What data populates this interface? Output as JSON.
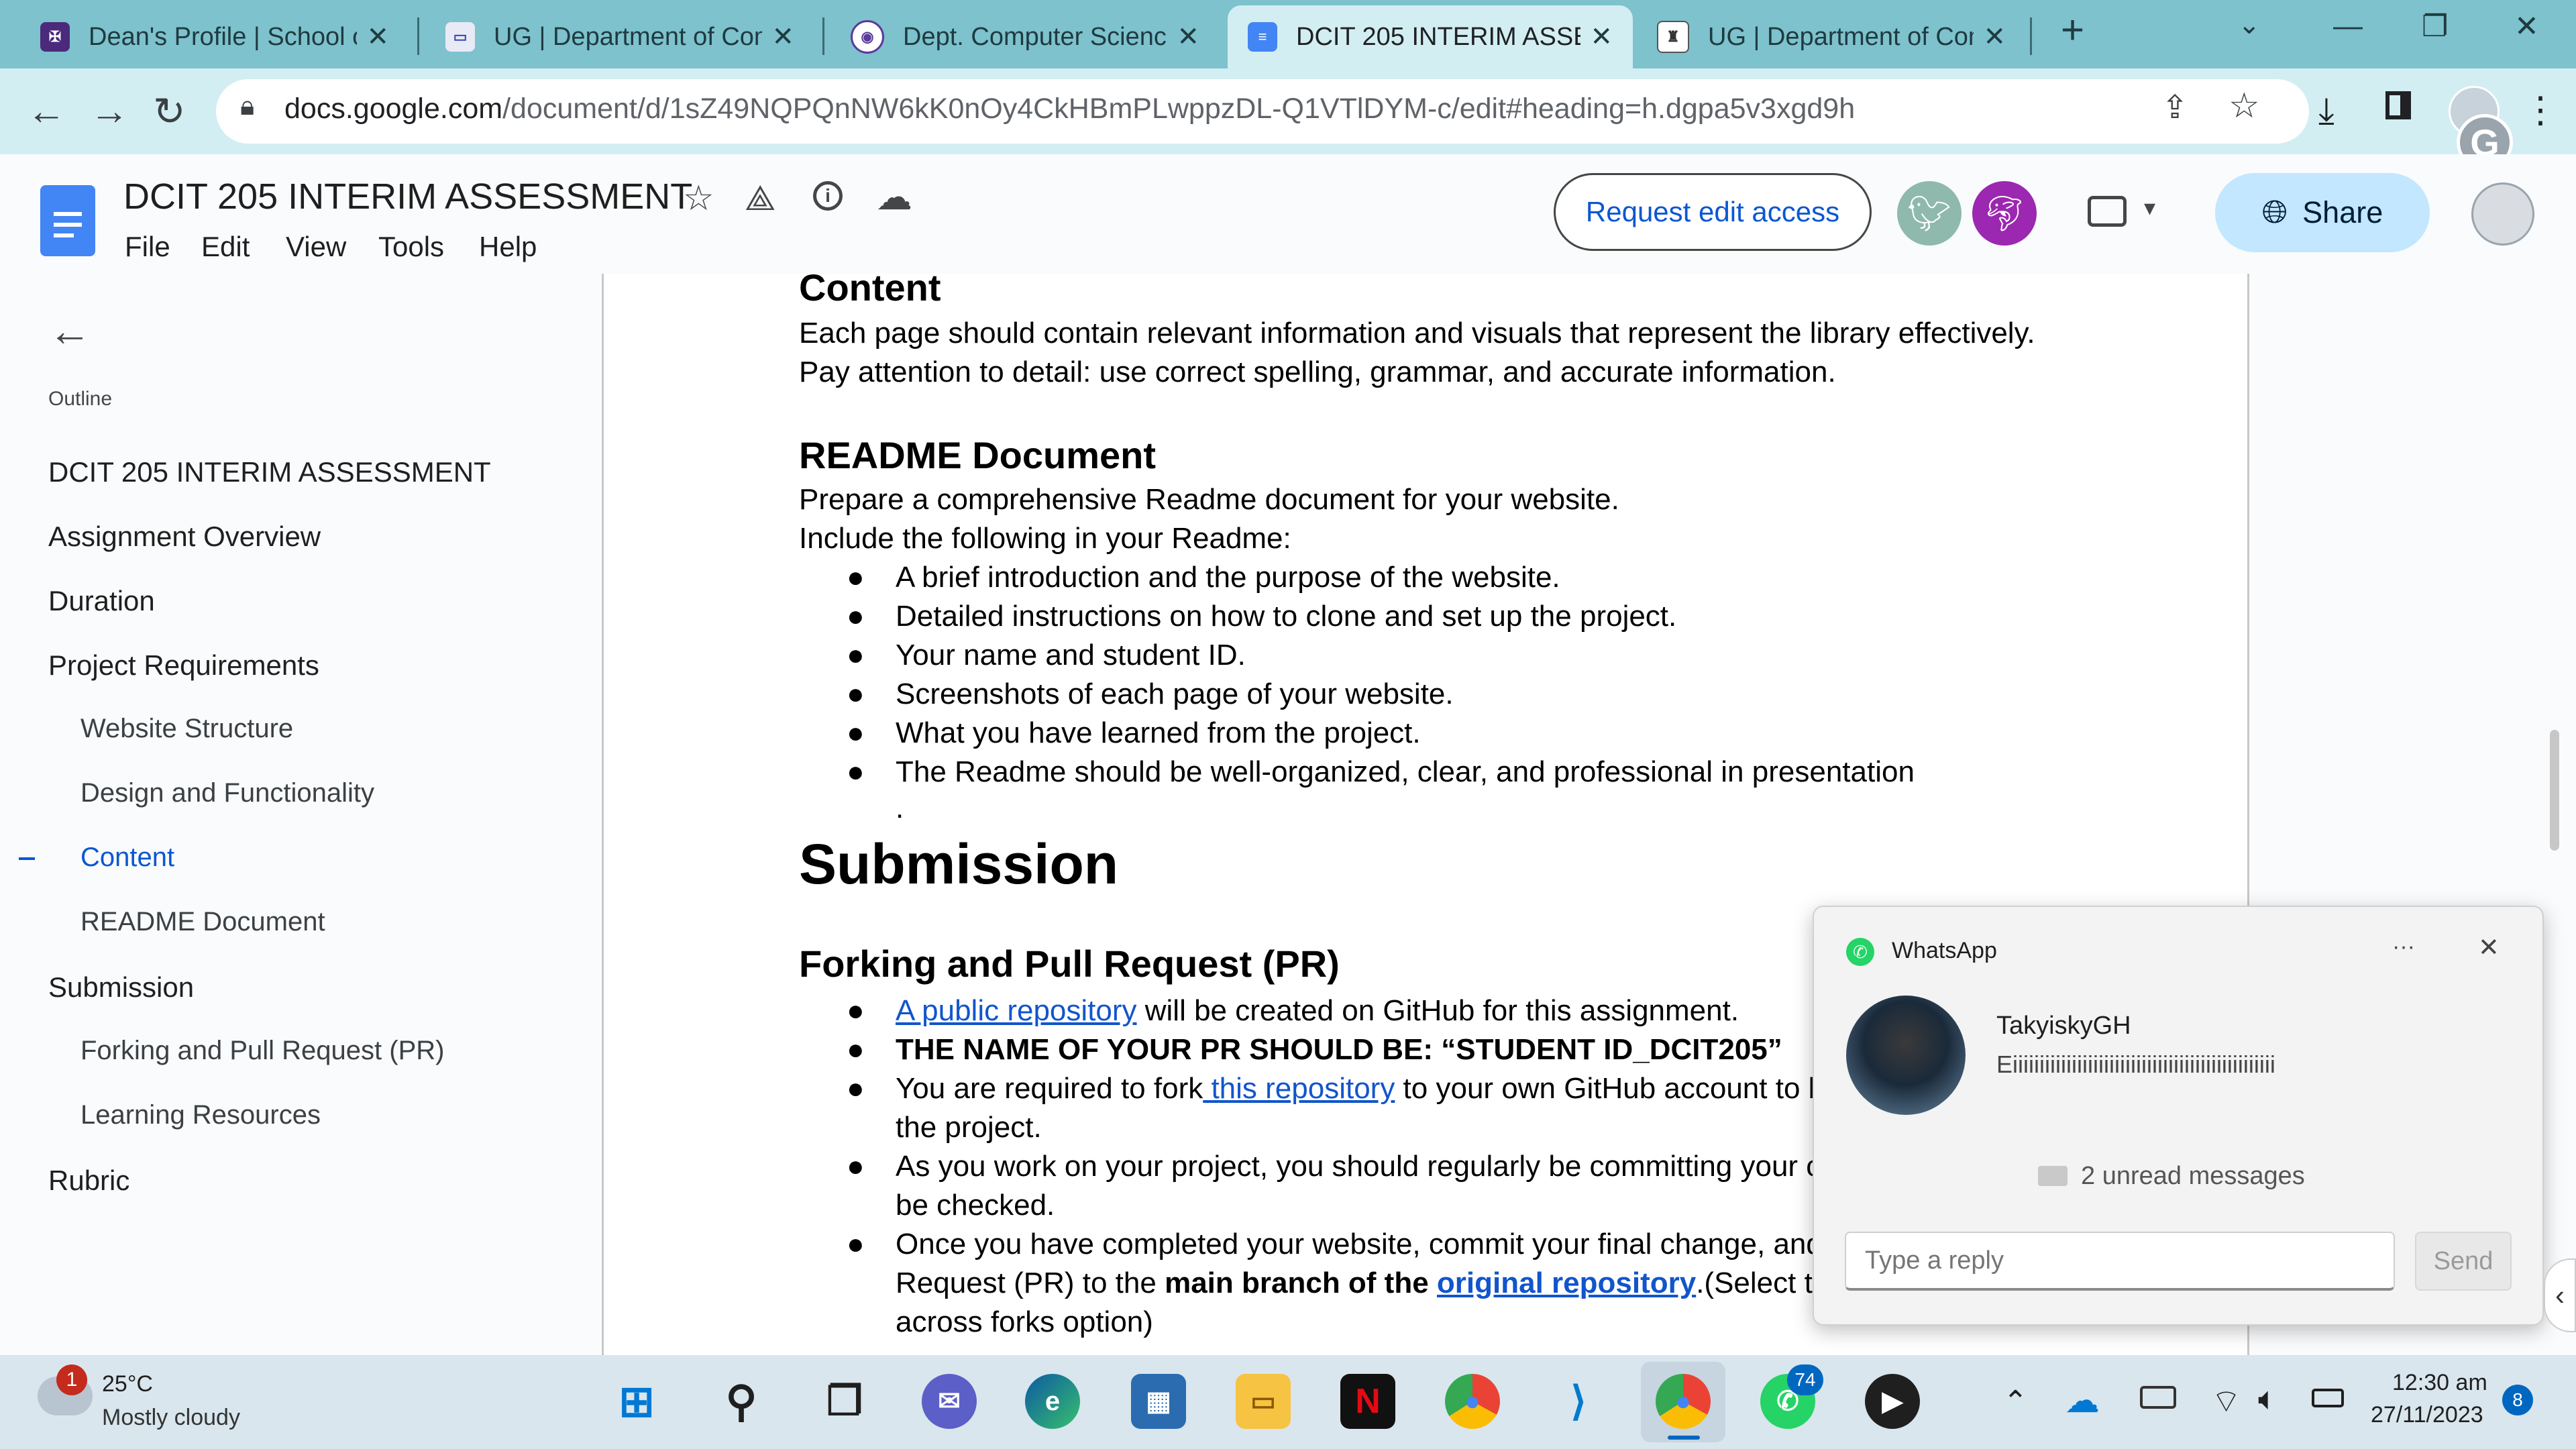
{
  "browser": {
    "tabs": [
      {
        "title": "Dean's Profile | School of",
        "active": false
      },
      {
        "title": "UG | Department of Com",
        "active": false
      },
      {
        "title": "Dept. Computer Science",
        "active": false
      },
      {
        "title": "DCIT 205 INTERIM ASSES",
        "active": true
      },
      {
        "title": "UG | Department of Com",
        "active": false
      }
    ],
    "url_host": "docs.google.com",
    "url_path": "/document/d/1sZ49NQPQnNW6kK0nOy4CkHBmPLwppzDL-Q1VTlDYM-c/edit#heading=h.dgpa5v3xgd9h"
  },
  "docs": {
    "title": "DCIT 205 INTERIM ASSESSMENT",
    "menu": [
      "File",
      "Edit",
      "View",
      "Tools",
      "Help"
    ],
    "request_edit_label": "Request edit access",
    "share_label": "Share"
  },
  "outline": {
    "heading": "Outline",
    "items": [
      {
        "label": "DCIT 205 INTERIM ASSESSMENT",
        "level": 1,
        "active": false
      },
      {
        "label": "Assignment Overview",
        "level": 1,
        "active": false
      },
      {
        "label": "Duration",
        "level": 1,
        "active": false
      },
      {
        "label": "Project Requirements",
        "level": 1,
        "active": false
      },
      {
        "label": "Website Structure",
        "level": 2,
        "active": false
      },
      {
        "label": "Design and Functionality",
        "level": 2,
        "active": false
      },
      {
        "label": "Content",
        "level": 2,
        "active": true
      },
      {
        "label": "README Document",
        "level": 2,
        "active": false
      },
      {
        "label": "Submission",
        "level": 1,
        "active": false
      },
      {
        "label": "Forking and Pull Request (PR)",
        "level": 2,
        "active": false
      },
      {
        "label": "Learning Resources",
        "level": 2,
        "active": false
      },
      {
        "label": "Rubric",
        "level": 1,
        "active": false
      }
    ]
  },
  "document": {
    "content_heading": "Content",
    "content_p1": "Each page should contain relevant information and visuals that represent the library effectively.",
    "content_p2": "Pay attention to detail: use correct spelling, grammar, and accurate information.",
    "readme_heading": "README Document",
    "readme_p1": "Prepare a comprehensive Readme document for your website.",
    "readme_p2": "Include the following in your Readme:",
    "readme_bullets": [
      "A brief introduction and the purpose of the website.",
      "Detailed instructions on how to clone and set up the project.",
      "Your name and student ID.",
      "Screenshots of each page of your website.",
      "What you have learned from the project.",
      "The Readme should be well-organized, clear, and professional in presentation"
    ],
    "stray_dot": ".",
    "submission_heading": "Submission",
    "fork_heading": "Forking and Pull Request (PR)",
    "fork_b1_link": "A public repository",
    "fork_b1_rest": " will be created on GitHub for this assignment.",
    "fork_b2": "THE NAME OF YOUR PR SHOULD BE: “STUDENT ID_DCIT205”",
    "fork_b3_a": "You are required to fork",
    "fork_b3_link": " this repository",
    "fork_b3_b": " to your own GitHub account to b",
    "fork_b3_line2": "the project.",
    "fork_b4_line1": "As you work on your project, you should regularly be committing your c",
    "fork_b4_line2": "be checked.",
    "fork_b5_line1": "Once you have completed your website, commit your final change, and",
    "fork_b5_a": "Request (PR) to the ",
    "fork_b5_bold": "main branch of the ",
    "fork_b5_link": "original repository",
    "fork_b5_b": ".(Select t",
    "fork_b5_line3": "across forks option)"
  },
  "whatsapp": {
    "app_name": "WhatsApp",
    "menu_dots": "···",
    "sender": "TakyiskyGH",
    "message": "Eiiiiiiiiiiiiiiiiiiiiiiiiiiiiiiiiiiiiiiiiiiiiiiiii",
    "unread": "2 unread messages",
    "reply_placeholder": "Type a reply",
    "send_label": "Send"
  },
  "taskbar": {
    "weather_temp": "25°C",
    "weather_desc": "Mostly cloudy",
    "weather_badge": "1",
    "whatsapp_badge": "74",
    "time": "12:30 am",
    "date": "27/11/2023",
    "notif_count": "8"
  },
  "colors": {
    "tabbar": "#7dc2cd",
    "accent": "#0b57d0",
    "link": "#1155cc"
  }
}
